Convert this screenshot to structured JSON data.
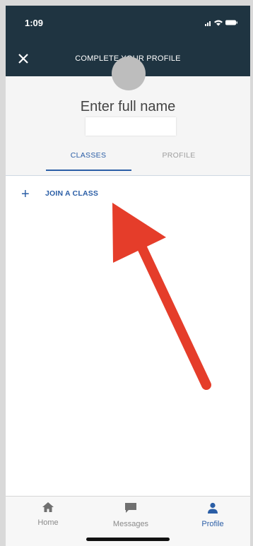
{
  "status_bar": {
    "time": "1:09"
  },
  "nav": {
    "title": "COMPLETE YOUR PROFILE",
    "close_icon": "close-icon"
  },
  "header": {
    "name_prompt": "Enter full name",
    "tabs": [
      {
        "label": "CLASSES",
        "selected": true
      },
      {
        "label": "PROFILE",
        "selected": false
      }
    ]
  },
  "classes": {
    "join_label": "JOIN A CLASS",
    "plus_icon": "plus-icon"
  },
  "annotation": {
    "arrow_color": "#e53d2a"
  },
  "tabbar": {
    "items": [
      {
        "label": "Home",
        "icon": "home-icon",
        "active": false
      },
      {
        "label": "Messages",
        "icon": "chat-icon",
        "active": false
      },
      {
        "label": "Profile",
        "icon": "person-icon",
        "active": true
      }
    ]
  },
  "colors": {
    "nav_bg": "#1f3441",
    "accent": "#2b5ea6"
  }
}
